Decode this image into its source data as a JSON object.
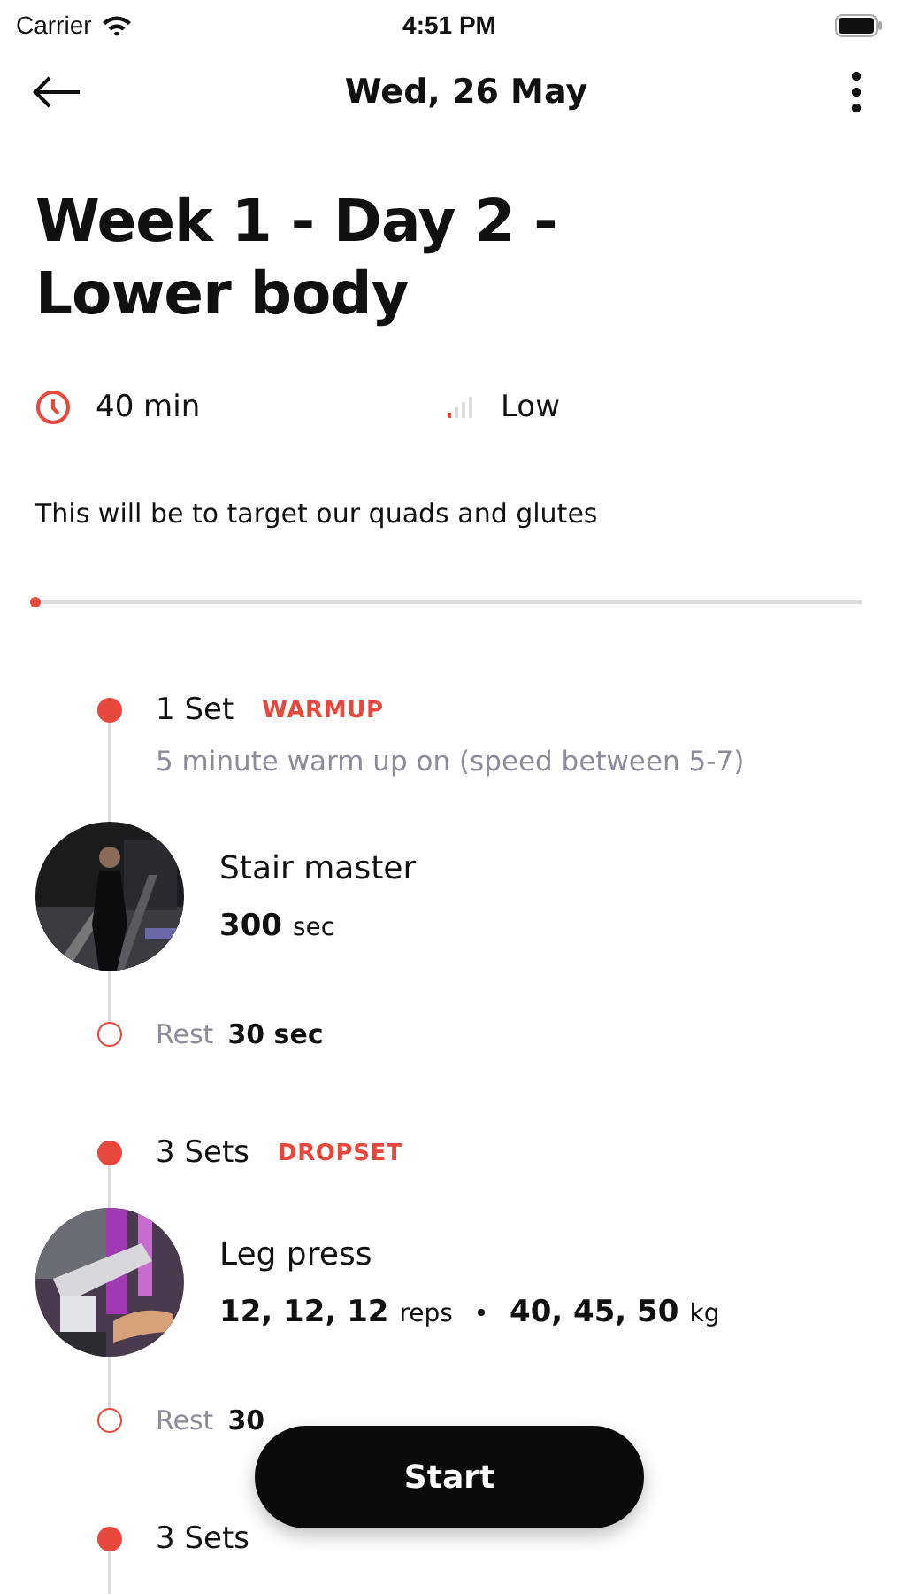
{
  "status_bar": {
    "carrier": "Carrier",
    "time": "4:51 PM"
  },
  "header": {
    "title": "Wed, 26 May"
  },
  "workout": {
    "title": "Week 1 - Day 2 - Lower body",
    "duration": "40 min",
    "intensity": {
      "label": "Low",
      "level": 0.25
    },
    "description": "This will be to target our quads and glutes",
    "progress": {
      "level": 0
    }
  },
  "groups": [
    {
      "sets": "1 Set",
      "tag": "WARMUP",
      "note": "5 minute warm up on (speed between 5-7)",
      "exercise": {
        "name": "Stair master",
        "stats": [
          {
            "value": "300",
            "unit": "sec"
          }
        ]
      },
      "rest": {
        "label": "Rest",
        "value": "30 sec"
      }
    },
    {
      "sets": "3 Sets",
      "tag": "DROPSET",
      "exercise": {
        "name": "Leg press",
        "stats": [
          {
            "value": "12, 12, 12",
            "unit": "reps"
          },
          {
            "value": "40, 45, 50",
            "unit": "kg"
          }
        ]
      },
      "rest": {
        "label": "Rest",
        "value": "30"
      }
    },
    {
      "sets": "3 Sets"
    }
  ],
  "start_button": {
    "label": "Start"
  }
}
